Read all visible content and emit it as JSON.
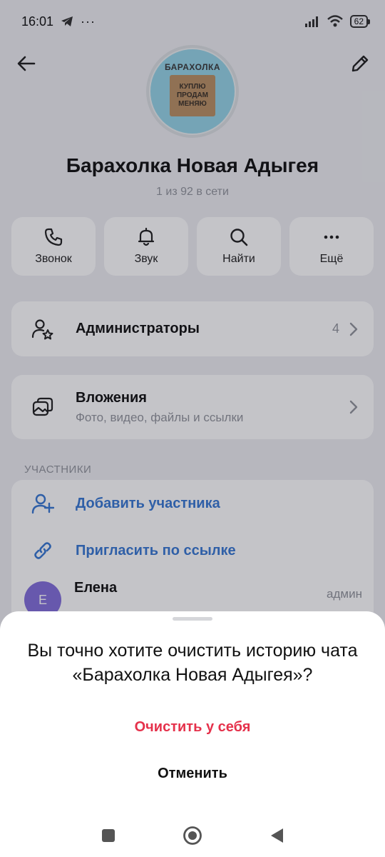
{
  "status": {
    "time": "16:01",
    "battery": "62"
  },
  "chat": {
    "title": "Барахолка Новая Адыгея",
    "subtitle": "1 из 92 в сети",
    "avatar_top": "БАРАХОЛКА",
    "avatar_lines": [
      "КУПЛЮ",
      "ПРОДАМ",
      "МЕНЯЮ"
    ]
  },
  "actions": [
    {
      "label": "Звонок",
      "icon": "phone-icon"
    },
    {
      "label": "Звук",
      "icon": "bell-icon"
    },
    {
      "label": "Найти",
      "icon": "search-icon"
    },
    {
      "label": "Ещё",
      "icon": "more-icon"
    }
  ],
  "admins": {
    "label": "Администраторы",
    "count": "4"
  },
  "attachments": {
    "label": "Вложения",
    "sub": "Фото, видео, файлы и ссылки"
  },
  "members": {
    "section": "УЧАСТНИКИ",
    "add": "Добавить участника",
    "invite": "Пригласить по ссылке",
    "first": {
      "initial": "Е",
      "name": "Елена",
      "role": "админ"
    }
  },
  "sheet": {
    "question": "Вы точно хотите очистить историю чата «Барахолка Новая Адыгея»?",
    "danger": "Очистить у себя",
    "cancel": "Отменить"
  },
  "colors": {
    "accent": "#2a6fd0",
    "danger": "#e5314b"
  }
}
